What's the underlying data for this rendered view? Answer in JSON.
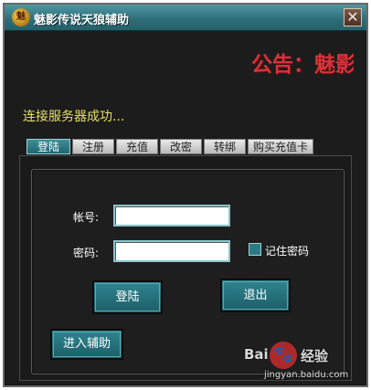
{
  "window": {
    "title": "魅影传说天狼辅助",
    "icon": "app-logo-icon",
    "icon_glyph": "魅",
    "close_glyph": "✕"
  },
  "notice": {
    "text": "公告：魅影"
  },
  "status": {
    "text": "连接服务器成功..."
  },
  "tabs": [
    {
      "label": "登陆",
      "active": true
    },
    {
      "label": "注册",
      "active": false
    },
    {
      "label": "充值",
      "active": false
    },
    {
      "label": "改密",
      "active": false
    },
    {
      "label": "转绑",
      "active": false
    },
    {
      "label": "购买充值卡",
      "active": false
    }
  ],
  "form": {
    "account_label": "帐号:",
    "account_value": "",
    "password_label": "密码:",
    "password_value": "",
    "remember_label": "记住密码",
    "remember_checked": false
  },
  "buttons": {
    "login": "登陆",
    "exit": "退出",
    "enter": "进入辅助"
  },
  "watermark": {
    "brand": "Bai",
    "paw": "🐾",
    "cn": "经验",
    "url": "jingyan.baidu.com"
  },
  "colors": {
    "accent": "#2c7f8a",
    "notice": "#d5333b",
    "status": "#e6e065",
    "background": "#1c1c1c"
  }
}
